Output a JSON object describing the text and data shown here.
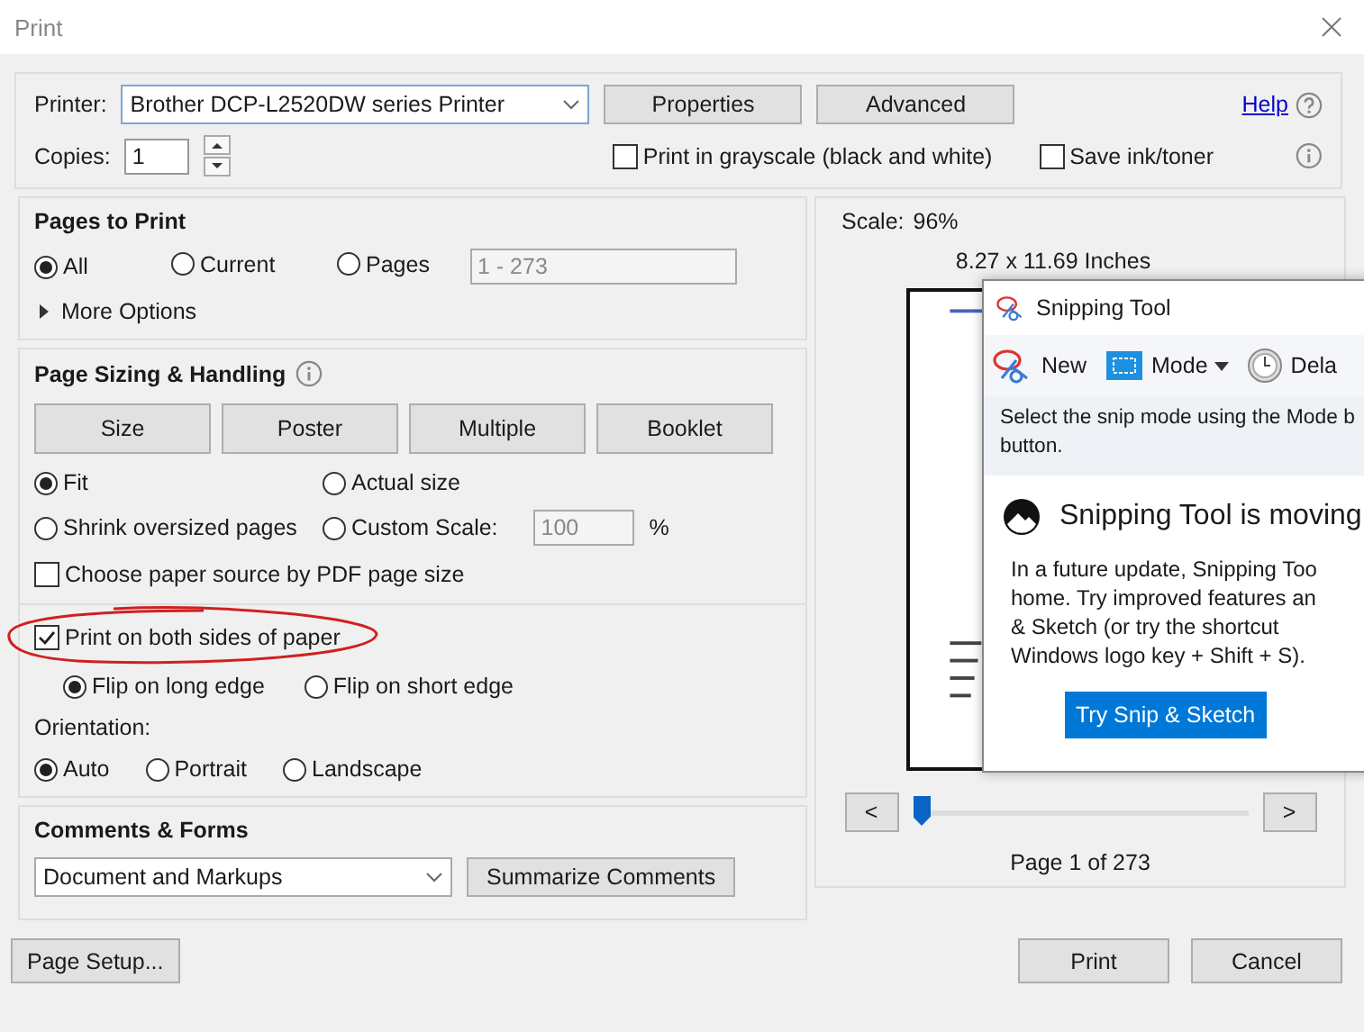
{
  "window": {
    "title": "Print"
  },
  "printer": {
    "label": "Printer:",
    "value": "Brother DCP-L2520DW series Printer"
  },
  "top_buttons": [
    "Properties",
    "Advanced"
  ],
  "help": {
    "label": "Help"
  },
  "copies": {
    "label": "Copies:",
    "value": "1"
  },
  "options": [
    {
      "label": "Print in grayscale (black and white)",
      "checked": false
    },
    {
      "label": "Save ink/toner",
      "checked": false
    }
  ],
  "pages_to_print": {
    "title": "Pages to Print",
    "choices": [
      {
        "label": "All",
        "selected": true
      },
      {
        "label": "Current",
        "selected": false
      },
      {
        "label": "Pages",
        "selected": false
      }
    ],
    "range": "1 - 273",
    "more_options": {
      "label": "More Options",
      "expanded": false
    }
  },
  "sizing": {
    "title": "Page Sizing & Handling",
    "modes": [
      "Size",
      "Poster",
      "Multiple",
      "Booklet"
    ],
    "fit_choices": [
      {
        "label": "Fit",
        "selected": true
      },
      {
        "label": "Actual size",
        "selected": false
      },
      {
        "label": "Shrink oversized pages",
        "selected": false
      },
      {
        "label": "Custom Scale:",
        "selected": false
      }
    ],
    "scale": "100",
    "percent": "%",
    "paper_source": {
      "label": "Choose paper source by PDF page size",
      "checked": false
    },
    "duplex": {
      "label": "Print on both sides of paper",
      "checked": true
    },
    "flip": [
      {
        "label": "Flip on long edge",
        "selected": true
      },
      {
        "label": "Flip on short edge",
        "selected": false
      }
    ],
    "orientation": {
      "label": "Orientation:",
      "choices": [
        {
          "label": "Auto",
          "selected": true
        },
        {
          "label": "Portrait",
          "selected": false
        },
        {
          "label": "Landscape",
          "selected": false
        }
      ]
    }
  },
  "comments": {
    "title": "Comments & Forms",
    "value": "Document and Markups",
    "button": "Summarize Comments"
  },
  "preview": {
    "scale_label": "Scale:",
    "scale": "96%",
    "size": "8.27 x 11.69 Inches",
    "prev": "<",
    "next": ">",
    "level": 0,
    "page": "Page 1 of 273"
  },
  "footer": {
    "page_setup": "Page Setup...",
    "print": "Print",
    "cancel": "Cancel"
  },
  "snipping_tool": {
    "title": "Snipping Tool",
    "toolbar": [
      {
        "label": "New",
        "kind": "new"
      },
      {
        "label": "Mode",
        "kind": "mode"
      },
      {
        "label": "Dela",
        "kind": "delay"
      }
    ],
    "hint": [
      "Select the snip mode using the Mode b",
      "button."
    ],
    "heading": "Snipping Tool is moving",
    "message": [
      "In a future update, Snipping Too",
      "home. Try improved features an",
      "& Sketch (or try the shortcut",
      "Windows logo key + Shift + S)."
    ],
    "action": "Try Snip & Sketch"
  }
}
